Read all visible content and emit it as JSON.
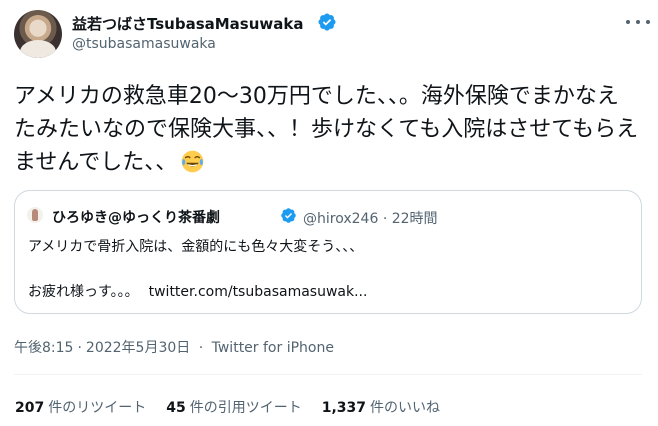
{
  "author": {
    "display_name": "益若つばさTsubasaMasuwaka",
    "handle": "@tsubasamasuwaka",
    "verified": true
  },
  "tweet": {
    "text": "アメリカの救急車20〜30万円でした、、。海外保険でまかなえたみたいなので保険大事、、！歩けなくても入院はさせてもらえませんでした、、",
    "emoji": "face-with-tears-of-joy"
  },
  "quote": {
    "display_name": "ひろゆき@ゆっくり茶番劇",
    "verified": true,
    "handle": "@hirox246",
    "separator": "·",
    "time": "22時間",
    "line1": "アメリカで骨折入院は、金額的にも色々大変そう、、、",
    "line2": "お疲れ様っす。。。",
    "link": "twitter.com/tsubasamasuwak..."
  },
  "meta": {
    "time": "午後8:15",
    "separator1": "·",
    "date": "2022年5月30日",
    "separator2": "·",
    "source": "Twitter for iPhone"
  },
  "stats": [
    {
      "count": "207",
      "label": "件のリツイート"
    },
    {
      "count": "45",
      "label": "件の引用ツイート"
    },
    {
      "count": "1,337",
      "label": "件のいいね"
    }
  ],
  "colors": {
    "text": "#0f1419",
    "secondary": "#536471",
    "verified": "#1d9bf0",
    "border": "#cfd9de"
  }
}
